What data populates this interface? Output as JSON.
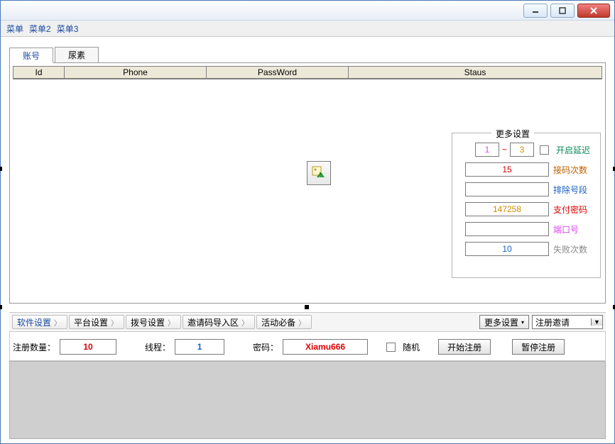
{
  "window": {
    "menus": [
      "菜单",
      "菜单2",
      "菜单3"
    ]
  },
  "tabs": [
    "账号",
    "尿素"
  ],
  "table": {
    "columns": [
      "Id",
      "Phone",
      "PassWord",
      "Staus"
    ]
  },
  "more_settings": {
    "title": "更多设置",
    "delay_from": "1",
    "delay_tilde": "~",
    "delay_to": "3",
    "open_delay_label": "开启延迟",
    "receive_times": "15",
    "receive_times_label": "接码次数",
    "exclude_seg": "",
    "exclude_seg_label": "排除号段",
    "pay_pwd": "147258",
    "pay_pwd_label": "支付密码",
    "port": "",
    "port_label": "端口号",
    "fail_times": "10",
    "fail_times_label": "失败次数"
  },
  "toolbar": {
    "items": [
      "软件设置",
      "平台设置",
      "拨号设置",
      "邀请码导入区",
      "活动必备"
    ],
    "more_btn": "更多设置",
    "combo_value": "注册邀请"
  },
  "form": {
    "reg_count_label": "注册数量：",
    "reg_count": "10",
    "threads_label": "线程：",
    "threads": "1",
    "pwd_label": "密码：",
    "pwd": "Xiamu666",
    "random_label": "随机",
    "start_btn": "开始注册",
    "pause_btn": "暂停注册"
  }
}
